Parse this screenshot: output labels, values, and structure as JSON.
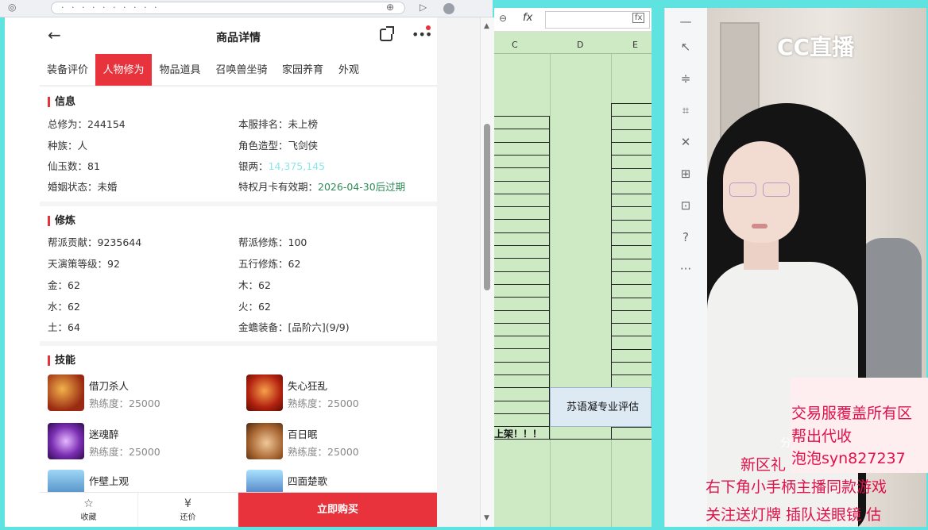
{
  "browser": {
    "url_glyphs": "· ·  · · ·  ·  ·  · · ·"
  },
  "shop": {
    "title": "商品详情",
    "tabs": [
      {
        "label": "装备评价",
        "active": false
      },
      {
        "label": "人物修为",
        "active": true
      },
      {
        "label": "物品道具",
        "active": false
      },
      {
        "label": "召唤兽坐骑",
        "active": false
      },
      {
        "label": "家园养育",
        "active": false
      },
      {
        "label": "外观",
        "active": false
      }
    ],
    "info": {
      "heading": "信息",
      "rows": [
        {
          "label": "总修为：",
          "value": "244154"
        },
        {
          "label": "本服排名：",
          "value": "未上榜"
        },
        {
          "label": "种族：",
          "value": "人"
        },
        {
          "label": "角色造型：",
          "value": "飞剑侠"
        },
        {
          "label": "仙玉数：",
          "value": "81"
        },
        {
          "label": "银两：",
          "value": "14,375,145"
        },
        {
          "label": "婚姻状态：",
          "value": "未婚"
        },
        {
          "label": "特权月卡有效期：",
          "value": "2026-04-30后过期"
        }
      ]
    },
    "cultivation": {
      "heading": "修炼",
      "rows": [
        {
          "label": "帮派贡献：",
          "value": "9235644"
        },
        {
          "label": "帮派修炼：",
          "value": "100"
        },
        {
          "label": "天演策等级：",
          "value": "92"
        },
        {
          "label": "五行修炼：",
          "value": "62"
        },
        {
          "label": "金：",
          "value": "62"
        },
        {
          "label": "木：",
          "value": "62"
        },
        {
          "label": "水：",
          "value": "62"
        },
        {
          "label": "火：",
          "value": "62"
        },
        {
          "label": "土：",
          "value": "64"
        },
        {
          "label": "金蟾装备：",
          "value": "[品阶六](9/9)"
        }
      ]
    },
    "skills": {
      "heading": "技能",
      "items": [
        {
          "name": "借刀杀人",
          "proficiency": "熟练度：25000"
        },
        {
          "name": "失心狂乱",
          "proficiency": "熟练度：25000"
        },
        {
          "name": "迷魂醉",
          "proficiency": "熟练度：25000"
        },
        {
          "name": "百日眠",
          "proficiency": "熟练度：25000"
        },
        {
          "name": "作壁上观",
          "proficiency": ""
        },
        {
          "name": "四面楚歌",
          "proficiency": ""
        }
      ]
    },
    "bottom": {
      "favorite_label": "收藏",
      "bargain_label": "还价",
      "buy_label": "立即购买"
    }
  },
  "sheet": {
    "fx_label": "fx",
    "fx_button": "fx",
    "columns": [
      "C",
      "D",
      "E"
    ],
    "eval_text": "苏语凝专业评估",
    "shelf_text": "上架！！！"
  },
  "stream": {
    "logo_text": "CC直播",
    "promo_lines": [
      "交易服覆盖所有区",
      "帮出代收",
      "泡泡syn827237",
      "新区礼",
      "右下角小手柄主播同款游戏",
      "关注送灯牌 插队送眼镜 估"
    ],
    "share_glyph": "分"
  },
  "colors": {
    "accent_red": "#e8323c",
    "sheet_green": "#cdeac4",
    "silver_value": "#8de6ea",
    "expiry_green": "#2e8b57",
    "promo_pink": "#e0124b"
  }
}
